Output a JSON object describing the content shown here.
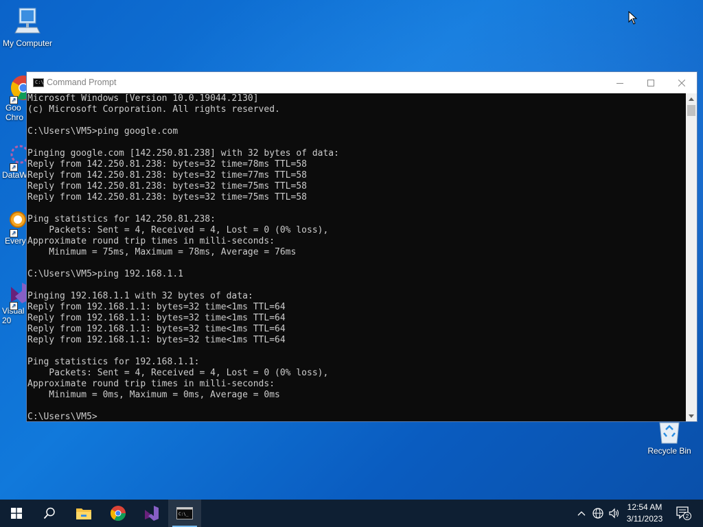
{
  "desktop": {
    "icons": [
      {
        "label": "My Computer"
      },
      {
        "label": "Goo\nChro"
      },
      {
        "label": "DataW"
      },
      {
        "label": "Every"
      },
      {
        "label": "Visual\n20"
      },
      {
        "label": "Recycle Bin"
      }
    ]
  },
  "window": {
    "title": "Command Prompt",
    "console_lines": [
      "Microsoft Windows [Version 10.0.19044.2130]",
      "(c) Microsoft Corporation. All rights reserved.",
      "",
      "C:\\Users\\VM5>ping google.com",
      "",
      "Pinging google.com [142.250.81.238] with 32 bytes of data:",
      "Reply from 142.250.81.238: bytes=32 time=78ms TTL=58",
      "Reply from 142.250.81.238: bytes=32 time=77ms TTL=58",
      "Reply from 142.250.81.238: bytes=32 time=75ms TTL=58",
      "Reply from 142.250.81.238: bytes=32 time=75ms TTL=58",
      "",
      "Ping statistics for 142.250.81.238:",
      "    Packets: Sent = 4, Received = 4, Lost = 0 (0% loss),",
      "Approximate round trip times in milli-seconds:",
      "    Minimum = 75ms, Maximum = 78ms, Average = 76ms",
      "",
      "C:\\Users\\VM5>ping 192.168.1.1",
      "",
      "Pinging 192.168.1.1 with 32 bytes of data:",
      "Reply from 192.168.1.1: bytes=32 time<1ms TTL=64",
      "Reply from 192.168.1.1: bytes=32 time<1ms TTL=64",
      "Reply from 192.168.1.1: bytes=32 time<1ms TTL=64",
      "Reply from 192.168.1.1: bytes=32 time<1ms TTL=64",
      "",
      "Ping statistics for 192.168.1.1:",
      "    Packets: Sent = 4, Received = 4, Lost = 0 (0% loss),",
      "Approximate round trip times in milli-seconds:",
      "    Minimum = 0ms, Maximum = 0ms, Average = 0ms",
      "",
      "C:\\Users\\VM5>"
    ]
  },
  "taskbar": {
    "clock_time": "12:54 AM",
    "clock_date": "3/11/2023",
    "notification_count": "2"
  },
  "colors": {
    "console_bg": "#0c0c0c",
    "console_fg": "#cccccc",
    "taskbar_bg": "#0e1f33",
    "desktop_bg": "#1179db"
  }
}
